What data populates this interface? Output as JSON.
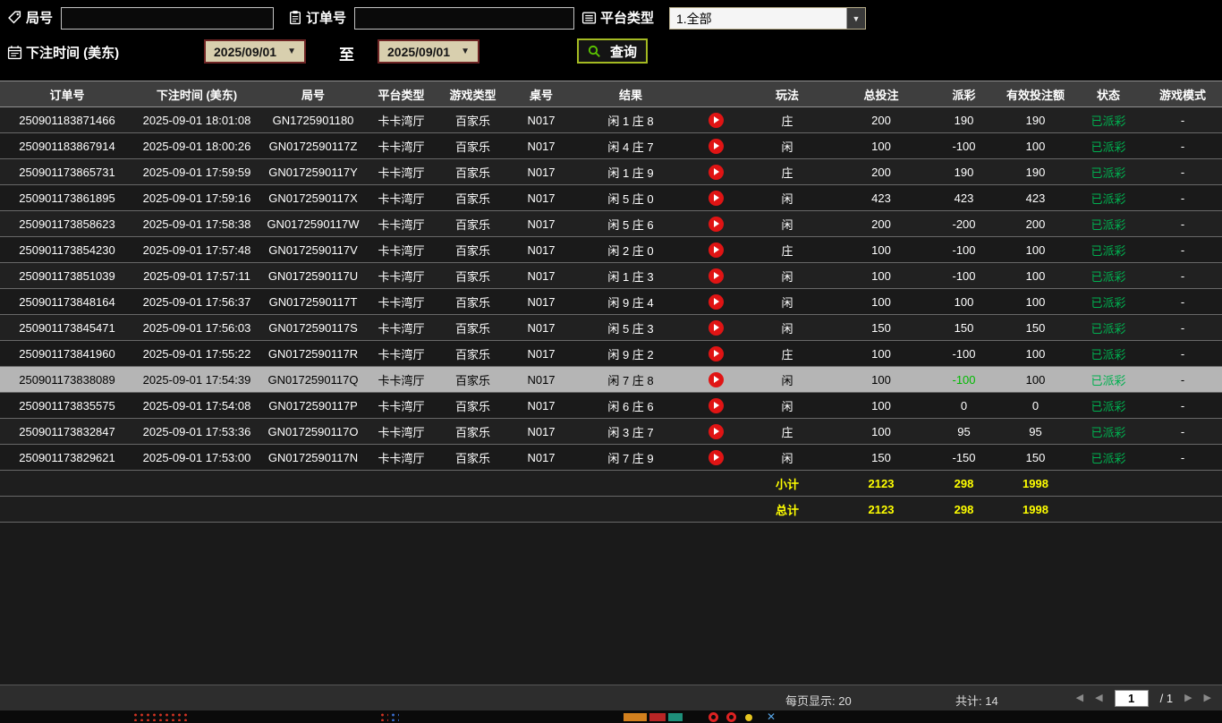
{
  "filters": {
    "round": {
      "label": "局号",
      "value": ""
    },
    "order": {
      "label": "订单号",
      "value": ""
    },
    "platform": {
      "label": "平台类型",
      "value": "1.全部"
    },
    "bet_time": {
      "label": "下注时间 (美东)",
      "from": "2025/09/01",
      "to_label": "至",
      "to": "2025/09/01"
    },
    "search": {
      "label": "查询"
    }
  },
  "table": {
    "headers": [
      "订单号",
      "下注时间 (美东)",
      "局号",
      "平台类型",
      "游戏类型",
      "桌号",
      "结果",
      "",
      "玩法",
      "总投注",
      "派彩",
      "有效投注额",
      "状态",
      "游戏模式"
    ],
    "rows": [
      {
        "order": "250901183871466",
        "time": "2025-09-01 18:01:08",
        "round": "GN1725901180",
        "platform": "卡卡湾厅",
        "game": "百家乐",
        "table_no": "N017",
        "result": "闲 1 庄 8",
        "play": "庄",
        "bet": "200",
        "payout": "190",
        "payout_color": "win",
        "valid": "190",
        "status": "已派彩",
        "mode": "-",
        "selected": false
      },
      {
        "order": "250901183867914",
        "time": "2025-09-01 18:00:26",
        "round": "GN0172590117Z",
        "platform": "卡卡湾厅",
        "game": "百家乐",
        "table_no": "N017",
        "result": "闲 4 庄 7",
        "play": "闲",
        "bet": "100",
        "payout": "-100",
        "payout_color": "lose",
        "valid": "100",
        "status": "已派彩",
        "mode": "-",
        "selected": false
      },
      {
        "order": "250901173865731",
        "time": "2025-09-01 17:59:59",
        "round": "GN0172590117Y",
        "platform": "卡卡湾厅",
        "game": "百家乐",
        "table_no": "N017",
        "result": "闲 1 庄 9",
        "play": "庄",
        "bet": "200",
        "payout": "190",
        "payout_color": "win",
        "valid": "190",
        "status": "已派彩",
        "mode": "-",
        "selected": false
      },
      {
        "order": "250901173861895",
        "time": "2025-09-01 17:59:16",
        "round": "GN0172590117X",
        "platform": "卡卡湾厅",
        "game": "百家乐",
        "table_no": "N017",
        "result": "闲 5 庄 0",
        "play": "闲",
        "bet": "423",
        "payout": "423",
        "payout_color": "win",
        "valid": "423",
        "status": "已派彩",
        "mode": "-",
        "selected": false
      },
      {
        "order": "250901173858623",
        "time": "2025-09-01 17:58:38",
        "round": "GN0172590117W",
        "platform": "卡卡湾厅",
        "game": "百家乐",
        "table_no": "N017",
        "result": "闲 5 庄 6",
        "play": "闲",
        "bet": "200",
        "payout": "-200",
        "payout_color": "lose",
        "valid": "200",
        "status": "已派彩",
        "mode": "-",
        "selected": false
      },
      {
        "order": "250901173854230",
        "time": "2025-09-01 17:57:48",
        "round": "GN0172590117V",
        "platform": "卡卡湾厅",
        "game": "百家乐",
        "table_no": "N017",
        "result": "闲 2 庄 0",
        "play": "庄",
        "bet": "100",
        "payout": "-100",
        "payout_color": "lose",
        "valid": "100",
        "status": "已派彩",
        "mode": "-",
        "selected": false
      },
      {
        "order": "250901173851039",
        "time": "2025-09-01 17:57:11",
        "round": "GN0172590117U",
        "platform": "卡卡湾厅",
        "game": "百家乐",
        "table_no": "N017",
        "result": "闲 1 庄 3",
        "play": "闲",
        "bet": "100",
        "payout": "-100",
        "payout_color": "lose",
        "valid": "100",
        "status": "已派彩",
        "mode": "-",
        "selected": false
      },
      {
        "order": "250901173848164",
        "time": "2025-09-01 17:56:37",
        "round": "GN0172590117T",
        "platform": "卡卡湾厅",
        "game": "百家乐",
        "table_no": "N017",
        "result": "闲 9 庄 4",
        "play": "闲",
        "bet": "100",
        "payout": "100",
        "payout_color": "win",
        "valid": "100",
        "status": "已派彩",
        "mode": "-",
        "selected": false
      },
      {
        "order": "250901173845471",
        "time": "2025-09-01 17:56:03",
        "round": "GN0172590117S",
        "platform": "卡卡湾厅",
        "game": "百家乐",
        "table_no": "N017",
        "result": "闲 5 庄 3",
        "play": "闲",
        "bet": "150",
        "payout": "150",
        "payout_color": "win",
        "valid": "150",
        "status": "已派彩",
        "mode": "-",
        "selected": false
      },
      {
        "order": "250901173841960",
        "time": "2025-09-01 17:55:22",
        "round": "GN0172590117R",
        "platform": "卡卡湾厅",
        "game": "百家乐",
        "table_no": "N017",
        "result": "闲 9 庄 2",
        "play": "庄",
        "bet": "100",
        "payout": "-100",
        "payout_color": "lose",
        "valid": "100",
        "status": "已派彩",
        "mode": "-",
        "selected": false
      },
      {
        "order": "250901173838089",
        "time": "2025-09-01 17:54:39",
        "round": "GN0172590117Q",
        "platform": "卡卡湾厅",
        "game": "百家乐",
        "table_no": "N017",
        "result": "闲 7 庄 8",
        "play": "闲",
        "bet": "100",
        "payout": "-100",
        "payout_color": "lose",
        "valid": "100",
        "status": "已派彩",
        "mode": "-",
        "selected": true
      },
      {
        "order": "250901173835575",
        "time": "2025-09-01 17:54:08",
        "round": "GN0172590117P",
        "platform": "卡卡湾厅",
        "game": "百家乐",
        "table_no": "N017",
        "result": "闲 6 庄 6",
        "play": "闲",
        "bet": "100",
        "payout": "0",
        "payout_color": "zero",
        "valid": "0",
        "status": "已派彩",
        "mode": "-",
        "selected": false
      },
      {
        "order": "250901173832847",
        "time": "2025-09-01 17:53:36",
        "round": "GN0172590117O",
        "platform": "卡卡湾厅",
        "game": "百家乐",
        "table_no": "N017",
        "result": "闲 3 庄 7",
        "play": "庄",
        "bet": "100",
        "payout": "95",
        "payout_color": "win",
        "valid": "95",
        "status": "已派彩",
        "mode": "-",
        "selected": false
      },
      {
        "order": "250901173829621",
        "time": "2025-09-01 17:53:00",
        "round": "GN0172590117N",
        "platform": "卡卡湾厅",
        "game": "百家乐",
        "table_no": "N017",
        "result": "闲 7 庄 9",
        "play": "闲",
        "bet": "150",
        "payout": "-150",
        "payout_color": "lose",
        "valid": "150",
        "status": "已派彩",
        "mode": "-",
        "selected": false
      }
    ],
    "subtotal": {
      "label": "小计",
      "bet": "2123",
      "payout": "298",
      "valid": "1998"
    },
    "total": {
      "label": "总计",
      "bet": "2123",
      "payout": "298",
      "valid": "1998"
    }
  },
  "footer": {
    "per_page": "每页显示: 20",
    "total_count": "共计: 14",
    "page": "1",
    "page_suffix": "/  1"
  },
  "colors": {
    "payout_win": "#d40000",
    "payout_lose": "#00cc00",
    "status_paid": "#00b050",
    "summary_text": "#ffff00",
    "search_accent": "#a4ba22"
  }
}
